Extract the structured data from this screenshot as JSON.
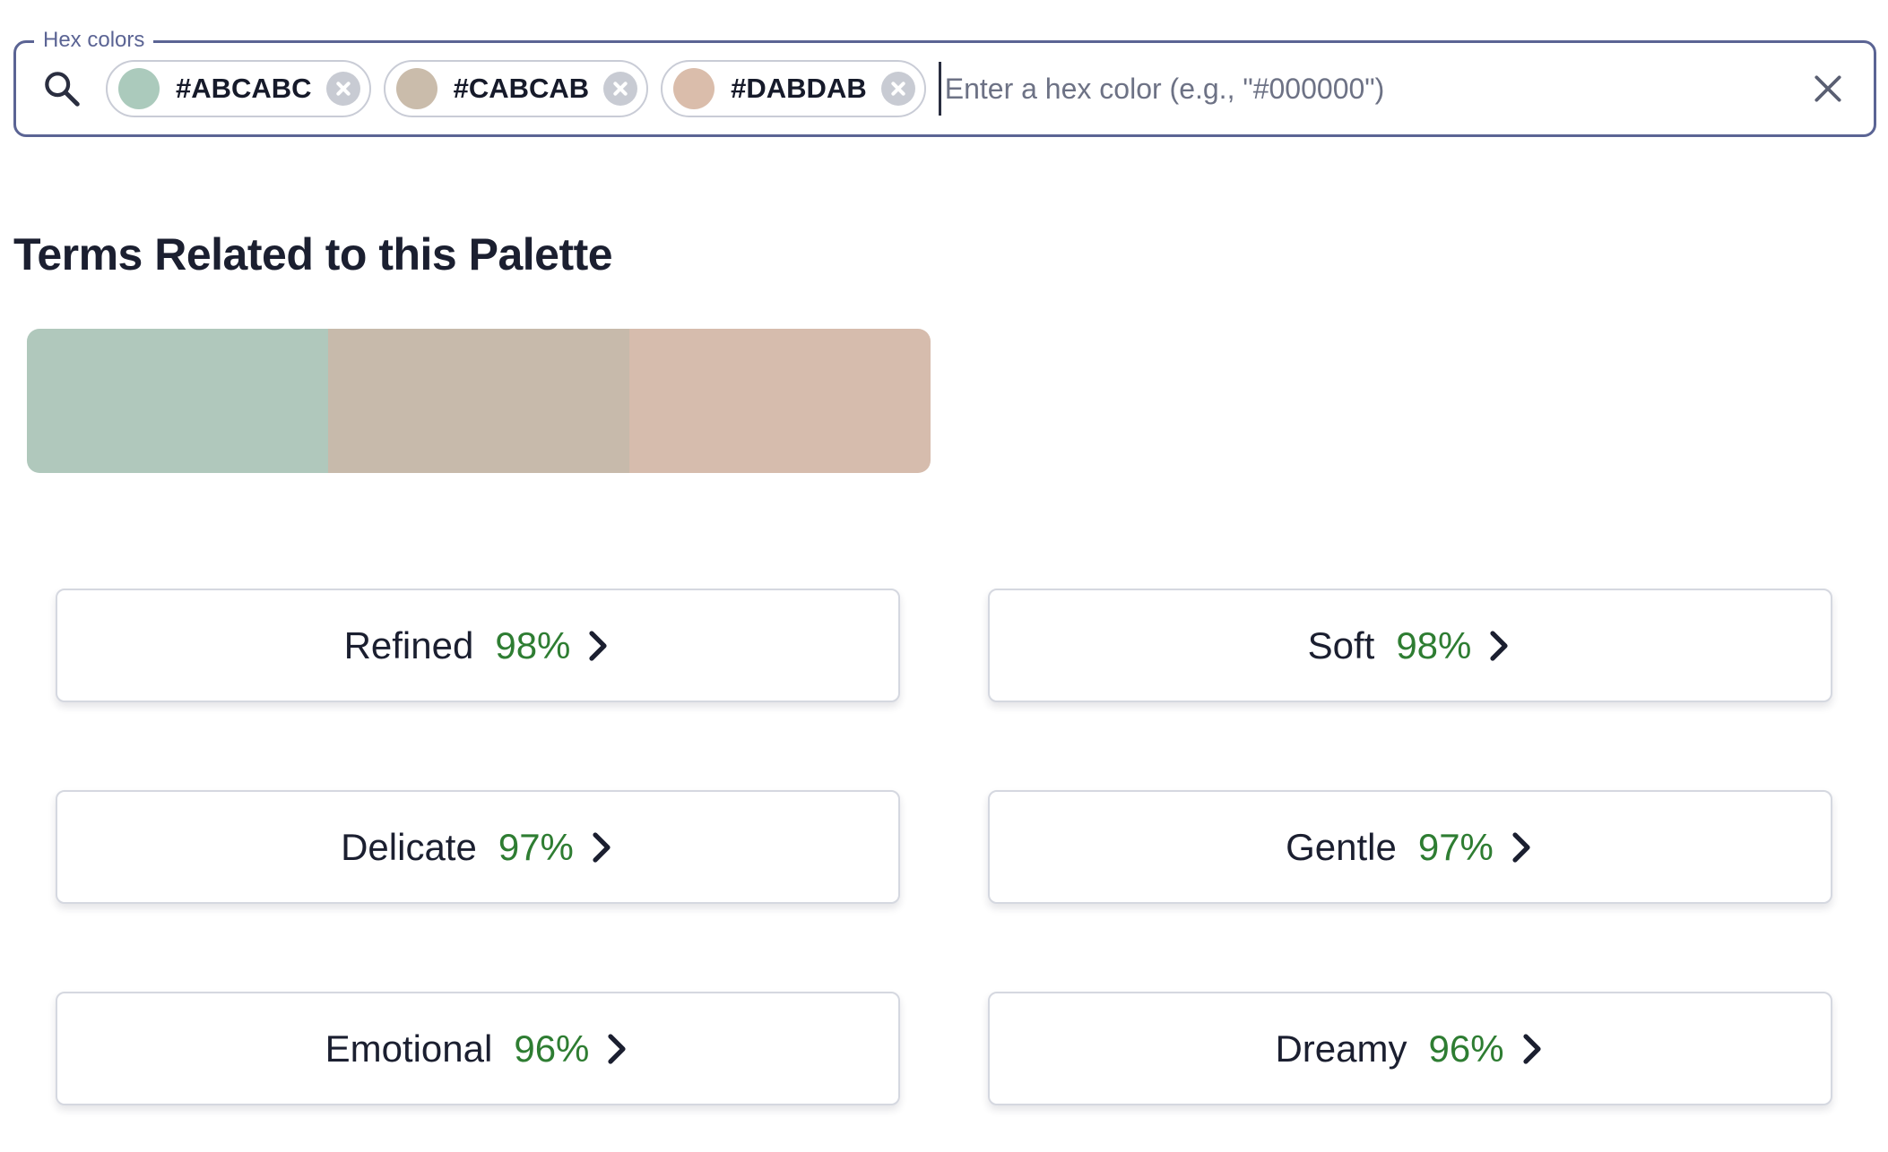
{
  "search": {
    "legend": "Hex colors",
    "placeholder": "Enter a hex color (e.g., \"#000000\")",
    "value": "",
    "chips": [
      {
        "label": "#ABCABC",
        "color": "#ABCABC"
      },
      {
        "label": "#CABCAB",
        "color": "#CABCAB"
      },
      {
        "label": "#DABDAB",
        "color": "#DABDAB"
      }
    ]
  },
  "section": {
    "title": "Terms Related to this Palette"
  },
  "palette": {
    "colors": [
      "#B0C8BC",
      "#C7BAAB",
      "#D6BCAD"
    ]
  },
  "terms": [
    {
      "name": "Refined",
      "score": "98%"
    },
    {
      "name": "Soft",
      "score": "98%"
    },
    {
      "name": "Delicate",
      "score": "97%"
    },
    {
      "name": "Gentle",
      "score": "97%"
    },
    {
      "name": "Emotional",
      "score": "96%"
    },
    {
      "name": "Dreamy",
      "score": "96%"
    }
  ],
  "colors": {
    "accent": "#5B6494",
    "score": "#2E7D32",
    "text": "#1B1F30"
  },
  "icons": {
    "search": "search-icon",
    "chip_remove": "close-circle-icon",
    "clear": "close-icon",
    "term_arrow": "chevron-right-icon"
  }
}
